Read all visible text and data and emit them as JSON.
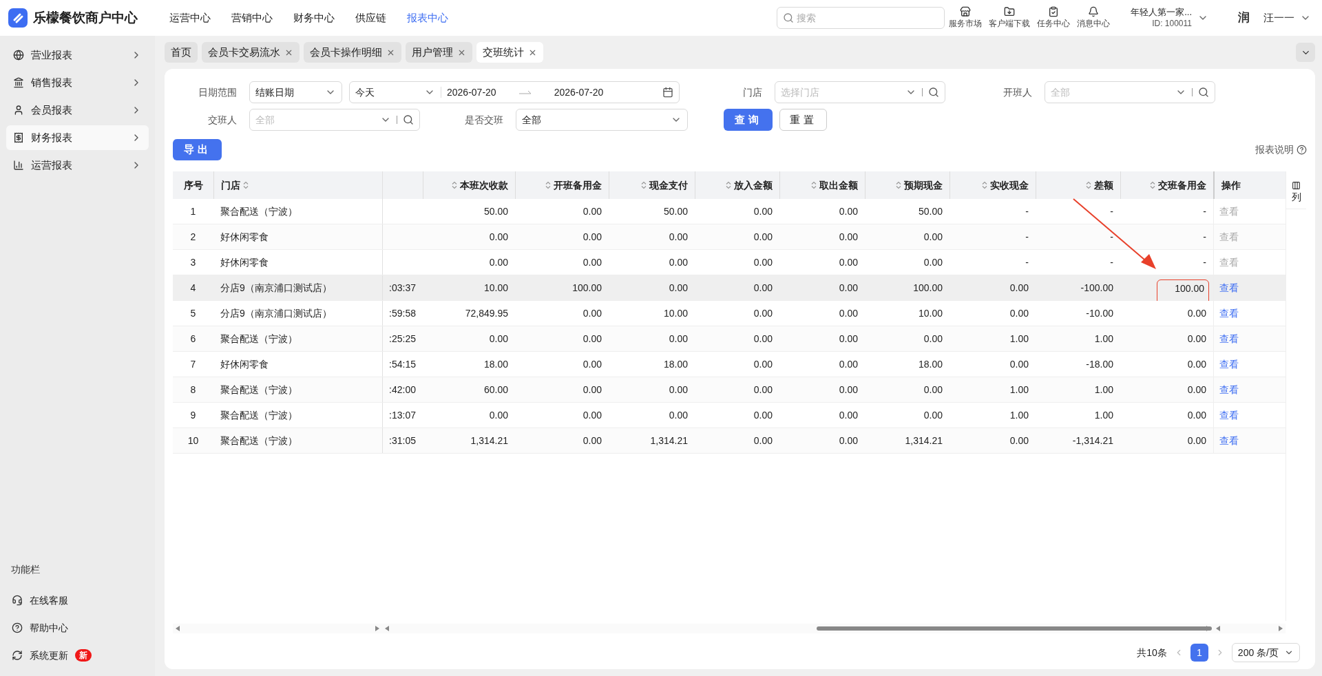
{
  "brand": {
    "name": "乐檬餐饮商户中心"
  },
  "top_nav": [
    {
      "label": "运营中心",
      "selected": false
    },
    {
      "label": "营销中心",
      "selected": false
    },
    {
      "label": "财务中心",
      "selected": false
    },
    {
      "label": "供应链",
      "selected": false
    },
    {
      "label": "报表中心",
      "selected": true
    }
  ],
  "search": {
    "placeholder": "搜索"
  },
  "tools": [
    {
      "label": "服务市场",
      "kind": "store"
    },
    {
      "label": "客户端下载",
      "kind": "download"
    },
    {
      "label": "任务中心",
      "kind": "task"
    },
    {
      "label": "消息中心",
      "kind": "bell"
    }
  ],
  "account": {
    "name": "年轻人第一家...",
    "id": "ID: 100011"
  },
  "user": {
    "avatar": "润",
    "name": "汪一一"
  },
  "sidebar": {
    "items": [
      {
        "label": "营业报表",
        "kind": "globe",
        "selected": false
      },
      {
        "label": "销售报表",
        "kind": "bank",
        "selected": false
      },
      {
        "label": "会员报表",
        "kind": "user",
        "selected": false
      },
      {
        "label": "财务报表",
        "kind": "receipt",
        "selected": true
      },
      {
        "label": "运营报表",
        "kind": "chart",
        "selected": false
      }
    ],
    "footer_title": "功能栏",
    "footer_items": [
      {
        "label": "在线客服",
        "kind": "headset"
      },
      {
        "label": "帮助中心",
        "kind": "help"
      },
      {
        "label": "系统更新",
        "kind": "refresh",
        "badge": "新"
      }
    ]
  },
  "tabs": [
    {
      "label": "首页",
      "closable": false,
      "selected": false
    },
    {
      "label": "会员卡交易流水",
      "closable": true,
      "selected": false
    },
    {
      "label": "会员卡操作明细",
      "closable": true,
      "selected": false
    },
    {
      "label": "用户管理",
      "closable": true,
      "selected": false
    },
    {
      "label": "交班统计",
      "closable": true,
      "selected": true
    }
  ],
  "filters": {
    "date_range": {
      "label": "日期范围",
      "type_value": "结账日期",
      "preset": "今天",
      "start": "2026-07-20",
      "end": "2026-07-20"
    },
    "store": {
      "label": "门店",
      "placeholder": "选择门店"
    },
    "opener": {
      "label": "开班人",
      "placeholder": "全部"
    },
    "handover_person": {
      "label": "交班人",
      "placeholder": "全部"
    },
    "handed_over": {
      "label": "是否交班",
      "value": "全部"
    }
  },
  "buttons": {
    "query": "查询",
    "reset": "重置",
    "export": "导出"
  },
  "report_note": "报表说明",
  "table": {
    "columns": [
      {
        "label": "序号",
        "sortable": false
      },
      {
        "label": "门店",
        "sortable": true
      },
      {
        "sortable": false
      },
      {
        "label": "本班次收款",
        "sortable": true
      },
      {
        "label": "开班备用金",
        "sortable": true
      },
      {
        "label": "现金支付",
        "sortable": true
      },
      {
        "label": "放入金额",
        "sortable": true
      },
      {
        "label": "取出金额",
        "sortable": true
      },
      {
        "label": "预期现金",
        "sortable": true
      },
      {
        "label": "实收现金",
        "sortable": true
      },
      {
        "label": "差额",
        "sortable": true
      },
      {
        "label": "交班备用金",
        "sortable": true
      },
      {
        "label": "操作",
        "sortable": false
      }
    ],
    "column_settings": "列",
    "rows": [
      {
        "cells": [
          "1",
          "聚合配送（宁波）",
          "",
          "50.00",
          "0.00",
          "50.00",
          "0.00",
          "0.00",
          "50.00",
          "-",
          "-",
          "-"
        ],
        "action": "查看",
        "disabled": true,
        "hovered": false,
        "marked": false
      },
      {
        "cells": [
          "2",
          "好休闲零食",
          "",
          "0.00",
          "0.00",
          "0.00",
          "0.00",
          "0.00",
          "0.00",
          "-",
          "-",
          "-"
        ],
        "action": "查看",
        "disabled": true,
        "hovered": false,
        "marked": false
      },
      {
        "cells": [
          "3",
          "好休闲零食",
          "",
          "0.00",
          "0.00",
          "0.00",
          "0.00",
          "0.00",
          "0.00",
          "-",
          "-",
          "-"
        ],
        "action": "查看",
        "disabled": true,
        "hovered": false,
        "marked": false
      },
      {
        "cells": [
          "4",
          "分店9（南京浦口测试店）",
          ":03:37",
          "10.00",
          "100.00",
          "0.00",
          "0.00",
          "0.00",
          "100.00",
          "0.00",
          "-100.00",
          "100.00"
        ],
        "action": "查看",
        "disabled": false,
        "hovered": true,
        "marked": true
      },
      {
        "cells": [
          "5",
          "分店9（南京浦口测试店）",
          ":59:58",
          "72,849.95",
          "0.00",
          "10.00",
          "0.00",
          "0.00",
          "10.00",
          "0.00",
          "-10.00",
          "0.00"
        ],
        "action": "查看",
        "disabled": false,
        "hovered": false,
        "marked": false
      },
      {
        "cells": [
          "6",
          "聚合配送（宁波）",
          ":25:25",
          "0.00",
          "0.00",
          "0.00",
          "0.00",
          "0.00",
          "0.00",
          "1.00",
          "1.00",
          "0.00"
        ],
        "action": "查看",
        "disabled": false,
        "hovered": false,
        "marked": false
      },
      {
        "cells": [
          "7",
          "好休闲零食",
          ":54:15",
          "18.00",
          "0.00",
          "18.00",
          "0.00",
          "0.00",
          "18.00",
          "0.00",
          "-18.00",
          "0.00"
        ],
        "action": "查看",
        "disabled": false,
        "hovered": false,
        "marked": false
      },
      {
        "cells": [
          "8",
          "聚合配送（宁波）",
          ":42:00",
          "60.00",
          "0.00",
          "0.00",
          "0.00",
          "0.00",
          "0.00",
          "1.00",
          "1.00",
          "0.00"
        ],
        "action": "查看",
        "disabled": false,
        "hovered": false,
        "marked": false
      },
      {
        "cells": [
          "9",
          "聚合配送（宁波）",
          ":13:07",
          "0.00",
          "0.00",
          "0.00",
          "0.00",
          "0.00",
          "0.00",
          "1.00",
          "1.00",
          "0.00"
        ],
        "action": "查看",
        "disabled": false,
        "hovered": false,
        "marked": false
      },
      {
        "cells": [
          "10",
          "聚合配送（宁波）",
          ":31:05",
          "1,314.21",
          "0.00",
          "1,314.21",
          "0.00",
          "0.00",
          "1,314.21",
          "0.00",
          "-1,314.21",
          "0.00"
        ],
        "action": "查看",
        "disabled": false,
        "hovered": false,
        "marked": false
      }
    ]
  },
  "pagination": {
    "total": "共10条",
    "pages": [
      {
        "label": "1",
        "selected": true
      }
    ],
    "page_size": "200 条/页"
  }
}
